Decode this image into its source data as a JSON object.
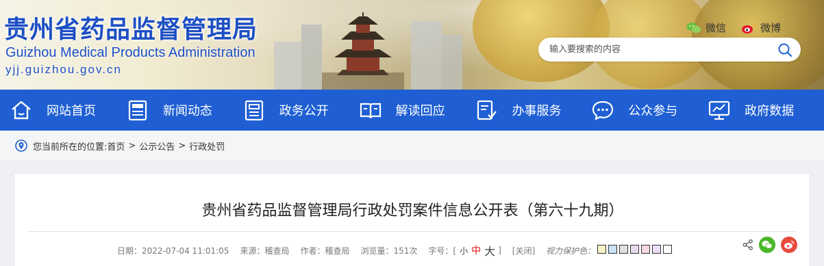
{
  "header": {
    "title_cn": "贵州省药品监督管理局",
    "title_en": "Guizhou Medical Products Administration",
    "domain": "yjj.guizhou.gov.cn",
    "wechat_label": "微信",
    "weibo_label": "微博",
    "search_placeholder": "输入要搜索的内容"
  },
  "nav": {
    "items": [
      {
        "label": "网站首页",
        "icon": "home-icon"
      },
      {
        "label": "新闻动态",
        "icon": "news-icon"
      },
      {
        "label": "政务公开",
        "icon": "document-icon"
      },
      {
        "label": "解读回应",
        "icon": "book-icon"
      },
      {
        "label": "办事服务",
        "icon": "service-form-icon"
      },
      {
        "label": "公众参与",
        "icon": "chat-icon"
      },
      {
        "label": "政府数据",
        "icon": "data-monitor-icon"
      }
    ],
    "color": "#1f5fd3"
  },
  "breadcrumb": {
    "prefix": "您当前所在的位置:",
    "items": [
      "首页",
      "公示公告",
      "行政处罚"
    ],
    "separator": ">"
  },
  "article": {
    "title": "贵州省药品监督管理局行政处罚案件信息公开表（第六十九期）",
    "date": "日期：2022-07-04 11:01:05",
    "source": "来源：稽查局",
    "author": "作者：稽查局",
    "views": "浏览量：151次",
    "font_label": "字号：[",
    "font_small": "小",
    "font_mid": "中",
    "font_big": "大",
    "font_close": "]",
    "close_label": "[关闭]",
    "vision_label": "视力保护色：",
    "vision_colors": [
      "#f8f2c6",
      "#c9e3f7",
      "#e0e0e0",
      "#e8d9ee",
      "#f4d6e4",
      "#e9dcf5",
      "#ffffff"
    ]
  }
}
